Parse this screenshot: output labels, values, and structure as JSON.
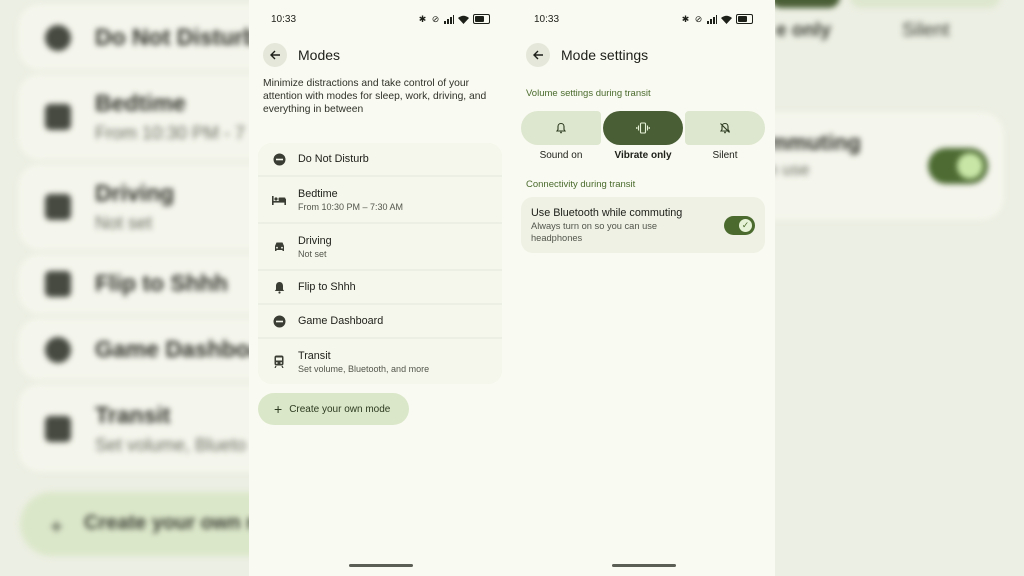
{
  "background": {
    "items": [
      {
        "title": "Do Not Disturb",
        "subtitle": ""
      },
      {
        "title": "Bedtime",
        "subtitle": "From 10:30 PM - 7"
      },
      {
        "title": "Driving",
        "subtitle": "Not set"
      },
      {
        "title": "Flip to Shhh",
        "subtitle": ""
      },
      {
        "title": "Game Dashboard",
        "subtitle": ""
      },
      {
        "title": "Transit",
        "subtitle": "Set volume, Blueto"
      }
    ],
    "create_label": "Create your own m",
    "right_top_a": "e only",
    "right_top_b": "Silent",
    "right_card_title": "mmuting",
    "right_card_sub": "n use"
  },
  "modes_screen": {
    "time": "10:33",
    "title": "Modes",
    "intro": "Minimize distractions and take control of your attention with modes for sleep, work, driving, and everything in between",
    "items": [
      {
        "icon": "dnd-icon",
        "title": "Do Not Disturb",
        "subtitle": ""
      },
      {
        "icon": "bed-icon",
        "title": "Bedtime",
        "subtitle": "From 10:30 PM – 7:30 AM"
      },
      {
        "icon": "car-icon",
        "title": "Driving",
        "subtitle": "Not set"
      },
      {
        "icon": "flip-phone-icon",
        "title": "Flip to Shhh",
        "subtitle": ""
      },
      {
        "icon": "game-dashboard-icon",
        "title": "Game Dashboard",
        "subtitle": ""
      },
      {
        "icon": "train-icon",
        "title": "Transit",
        "subtitle": "Set volume, Bluetooth, and more"
      }
    ],
    "create_label": "Create your own mode"
  },
  "settings_screen": {
    "time": "10:33",
    "title": "Mode settings",
    "volume_section": "Volume settings during transit",
    "volume_options": [
      {
        "icon": "bell-icon",
        "label": "Sound on",
        "selected": false
      },
      {
        "icon": "vibrate-icon",
        "label": "Vibrate only",
        "selected": true
      },
      {
        "icon": "bell-off-icon",
        "label": "Silent",
        "selected": false
      }
    ],
    "connectivity_section": "Connectivity during transit",
    "bluetooth_title": "Use Bluetooth while commuting",
    "bluetooth_subtitle": "Always turn on so you can use headphones",
    "bluetooth_enabled": true
  },
  "colors": {
    "accent": "#4b6b2e",
    "selected_segment": "#4a5e36",
    "segment": "#dde6ce",
    "screen_bg": "#f9faf1"
  }
}
